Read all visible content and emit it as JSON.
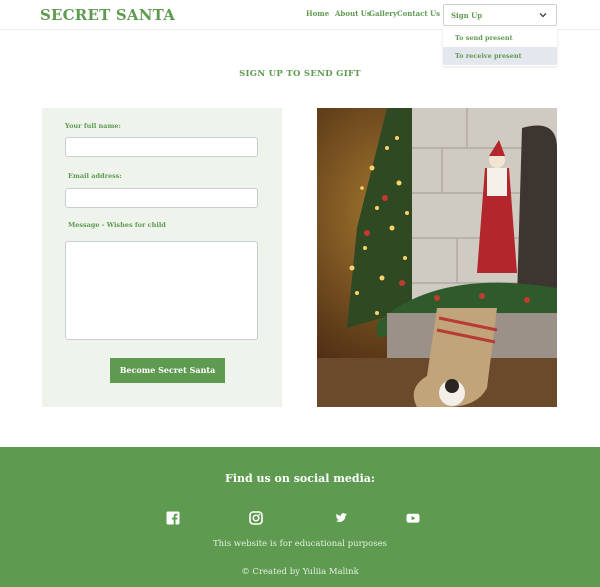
{
  "header": {
    "brand": "SECRET SANTA",
    "nav": [
      "Home",
      "About Us",
      "Gallery",
      "Contact Us"
    ],
    "dropdown": {
      "selected": "Sign Up",
      "options": [
        "To send present",
        "To receive present"
      ],
      "highlighted_option": "To receive present"
    }
  },
  "main": {
    "title": "SIGN UP TO SEND GIFT",
    "form": {
      "name_label": "Your full name:",
      "email_label": "Email address:",
      "message_label": "Message - Wishes for child",
      "submit_label": "Become Secret Santa"
    },
    "photo": {
      "icon": "christmas-stocking-photo"
    }
  },
  "footer": {
    "title": "Find us on social media:",
    "social_icons": [
      "facebook-icon",
      "instagram-icon",
      "twitter-icon",
      "youtube-icon"
    ],
    "note": "This website is for educational purposes",
    "credit": "© Created by Yuliia Malink"
  },
  "colors": {
    "brand_green": "#5e9a50",
    "panel_bg": "#eef3ec",
    "menu_highlight": "#e4e7ee"
  }
}
